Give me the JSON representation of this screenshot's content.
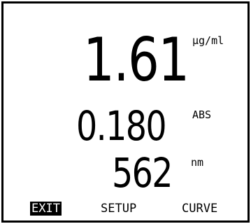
{
  "readings": {
    "concentration": {
      "value": "1.61",
      "unit": "µg/ml"
    },
    "absorbance": {
      "value": "0.180",
      "unit": "ABS"
    },
    "wavelength": {
      "value": "562",
      "unit": "nm"
    }
  },
  "softkeys": [
    {
      "label": "EXIT",
      "selected": true
    },
    {
      "label": "SETUP",
      "selected": false
    },
    {
      "label": "CURVE",
      "selected": false
    }
  ],
  "colors": {
    "background": "#ffffff",
    "foreground": "#000000"
  }
}
